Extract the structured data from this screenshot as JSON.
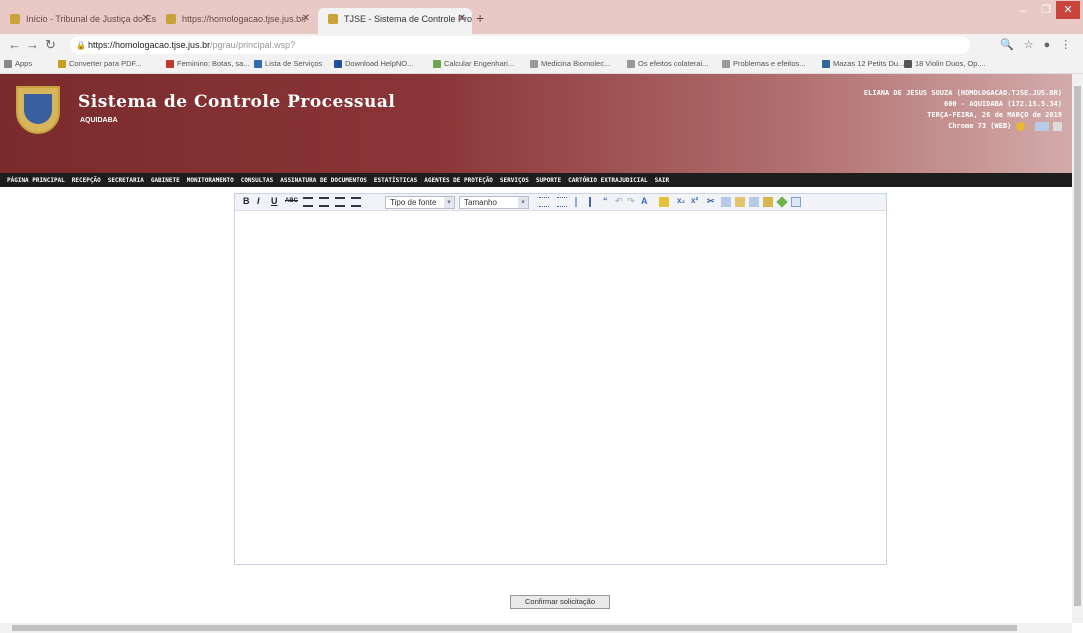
{
  "browser": {
    "tabs": [
      {
        "label": "Início - Tribunal de Justiça do Est"
      },
      {
        "label": "https://homologacao.tjse.jus.br/"
      },
      {
        "label": "TJSE - Sistema de Controle Proc"
      }
    ],
    "new_tab": "+",
    "url_host": "https://homologacao.tjse.jus.br",
    "url_path": "/pgrau/principal.wsp?",
    "bookmarks": [
      {
        "label": "Apps",
        "color": "#888888"
      },
      {
        "label": "Converter para PDF...",
        "color": "#c8a020"
      },
      {
        "label": "Feminino: Botas, sa...",
        "color": "#c0392b"
      },
      {
        "label": "Lista de Serviços",
        "color": "#2e6cb0"
      },
      {
        "label": "Download HelpNO...",
        "color": "#1f4fa0"
      },
      {
        "label": "Calcular Engenhari...",
        "color": "#6aa84f"
      },
      {
        "label": "Medicina Biomolec...",
        "color": "#999999"
      },
      {
        "label": "Os efeitos colaterai...",
        "color": "#999999"
      },
      {
        "label": "Problemas e efeitos...",
        "color": "#999999"
      },
      {
        "label": "Mazas 12 Petits Du...",
        "color": "#336699"
      },
      {
        "label": "18 Violin Duos, Op....",
        "color": "#555555"
      }
    ]
  },
  "header": {
    "title": "Sistema de Controle Processual",
    "subtitle": "AQUIDABA",
    "user_lines": [
      "ELIANA DE JESUS SOUZA (HOMOLOGACAO.TJSE.JUS.BR)",
      "600 - AQUIDABA (172.15.5.34)",
      "TERÇA-FEIRA, 26 de MARÇO de 2019",
      "Chrome 73 (WEB)"
    ]
  },
  "menu": [
    "PÁGINA PRINCIPAL",
    "RECEPÇÃO",
    "SECRETARIA",
    "GABINETE",
    "MONITORAMENTO",
    "CONSULTAS",
    "ASSINATURA DE DOCUMENTOS",
    "ESTATÍSTICAS",
    "AGENTES DE PROTEÇÃO",
    "SERVIÇOS",
    "SUPORTE",
    "CARTÓRIO EXTRAJUDICIAL",
    "SAIR"
  ],
  "editor": {
    "bold": "B",
    "italic": "I",
    "underline": "U",
    "strike": "ABC",
    "font_select": "Tipo de fonte",
    "size_select": "Tamanho"
  },
  "confirm_button": "Confirmar solicitação"
}
